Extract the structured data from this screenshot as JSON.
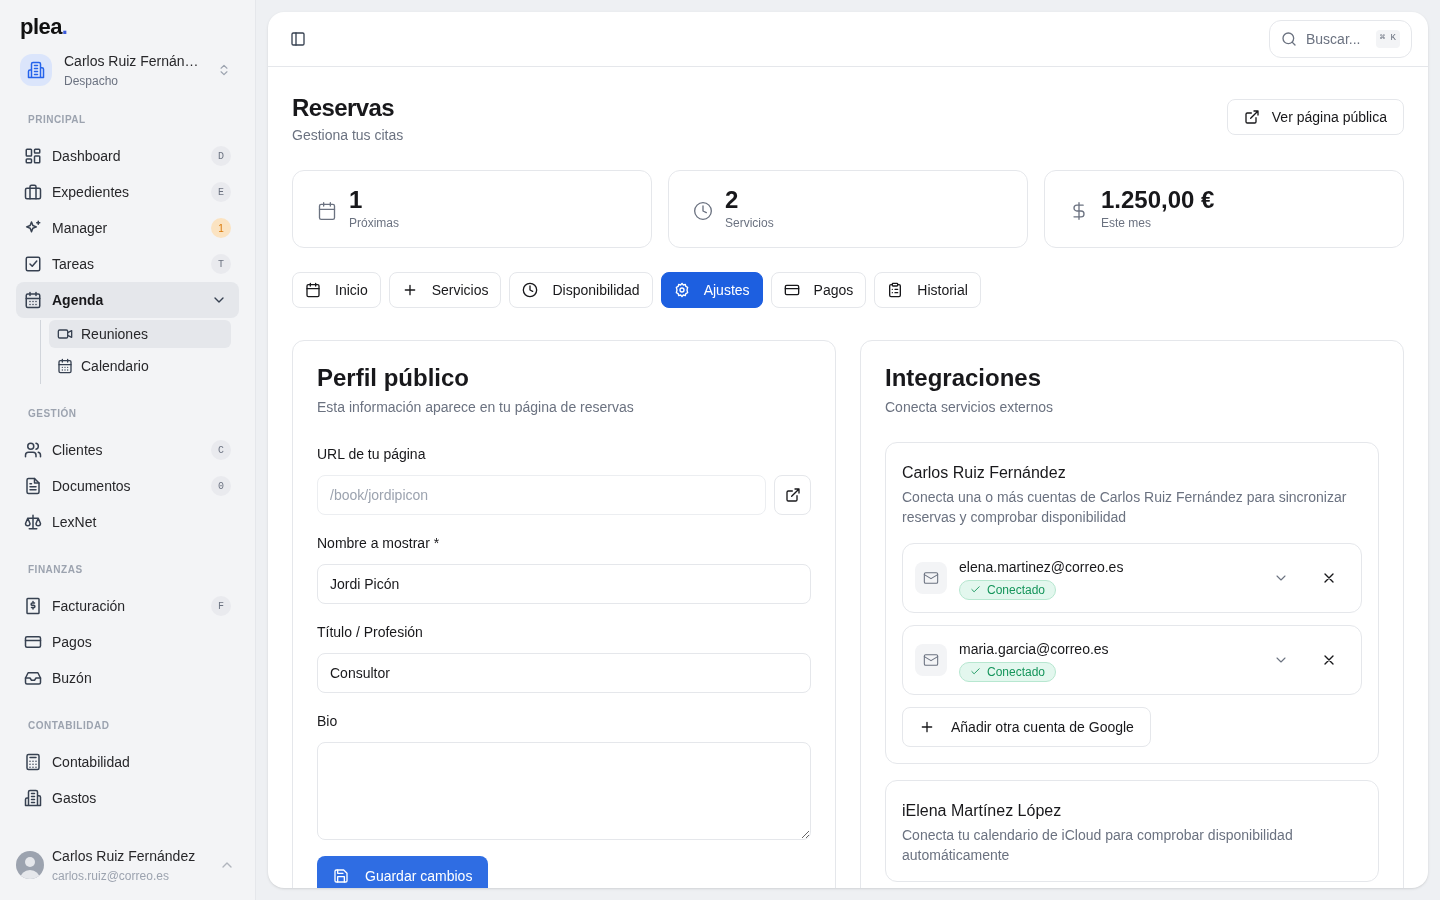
{
  "logo": {
    "name": "plea",
    "mark": "."
  },
  "workspace": {
    "name": "Carlos Ruiz Fernán…",
    "type": "Despacho"
  },
  "sidebar": {
    "sections": [
      {
        "title": "PRINCIPAL",
        "items": [
          {
            "label": "Dashboard",
            "selected": false,
            "badge": {
              "kind": "shortcut",
              "text": "D"
            }
          },
          {
            "label": "Expedientes",
            "selected": false,
            "badge": {
              "kind": "shortcut",
              "text": "E"
            }
          },
          {
            "label": "Manager",
            "selected": false,
            "badge": {
              "kind": "count",
              "text": "1"
            }
          },
          {
            "label": "Tareas",
            "selected": false,
            "badge": {
              "kind": "shortcut",
              "text": "T"
            }
          },
          {
            "label": "Agenda",
            "selected": true,
            "expanded": true,
            "children": [
              {
                "label": "Reuniones",
                "selected": true
              },
              {
                "label": "Calendario",
                "selected": false
              }
            ]
          }
        ]
      },
      {
        "title": "GESTIÓN",
        "items": [
          {
            "label": "Clientes",
            "selected": false,
            "badge": {
              "kind": "shortcut",
              "text": "C"
            }
          },
          {
            "label": "Documentos",
            "selected": false,
            "badge": {
              "kind": "shortcut",
              "text": "0"
            }
          },
          {
            "label": "LexNet",
            "selected": false
          }
        ]
      },
      {
        "title": "FINANZAS",
        "items": [
          {
            "label": "Facturación",
            "selected": false,
            "badge": {
              "kind": "shortcut",
              "text": "F"
            }
          },
          {
            "label": "Pagos",
            "selected": false
          },
          {
            "label": "Buzón",
            "selected": false
          }
        ]
      },
      {
        "title": "CONTABILIDAD",
        "items": [
          {
            "label": "Contabilidad",
            "selected": false
          },
          {
            "label": "Gastos",
            "selected": false
          }
        ]
      }
    ]
  },
  "user": {
    "name": "Carlos Ruiz Fernández",
    "email": "carlos.ruiz@correo.es"
  },
  "search": {
    "placeholder": "Buscar...",
    "shortcut": "⌘ K"
  },
  "page": {
    "title": "Reservas",
    "subtitle": "Gestiona tus citas",
    "action": "Ver página pública"
  },
  "stats": [
    {
      "value": "1",
      "label": "Próximas"
    },
    {
      "value": "2",
      "label": "Servicios"
    },
    {
      "value": "1.250,00 €",
      "label": "Este mes"
    }
  ],
  "tabs": [
    {
      "label": "Inicio",
      "selected": false
    },
    {
      "label": "Servicios",
      "selected": false
    },
    {
      "label": "Disponibilidad",
      "selected": false
    },
    {
      "label": "Ajustes",
      "selected": true
    },
    {
      "label": "Pagos",
      "selected": false
    },
    {
      "label": "Historial",
      "selected": false
    }
  ],
  "profile": {
    "title": "Perfil público",
    "subtitle": "Esta información aparece en tu página de reservas",
    "fields": [
      {
        "label": "URL de tu página",
        "kind": "link",
        "placeholder": "/book/jordipicon"
      },
      {
        "label": "Nombre a mostrar *",
        "kind": "text",
        "value": "Jordi Picón"
      },
      {
        "label": "Título / Profesión",
        "kind": "text",
        "value": "Consultor"
      },
      {
        "label": "Bio",
        "kind": "textarea"
      }
    ],
    "save": "Guardar cambios"
  },
  "integrations": {
    "title": "Integraciones",
    "subtitle": "Conecta servicios externos",
    "providers": [
      {
        "name": "Carlos Ruiz Fernández",
        "description": "Conecta una o más cuentas de Carlos Ruiz Fernández para sincronizar reservas y comprobar disponibilidad",
        "accounts": [
          {
            "email": "elena.martinez@correo.es",
            "status": "Conectado"
          },
          {
            "email": "maria.garcia@correo.es",
            "status": "Conectado"
          }
        ],
        "add": "Añadir otra cuenta de Google"
      },
      {
        "name": "iElena Martínez López",
        "description": "Conecta tu calendario de iCloud para comprobar disponibilidad automáticamente"
      }
    ]
  }
}
